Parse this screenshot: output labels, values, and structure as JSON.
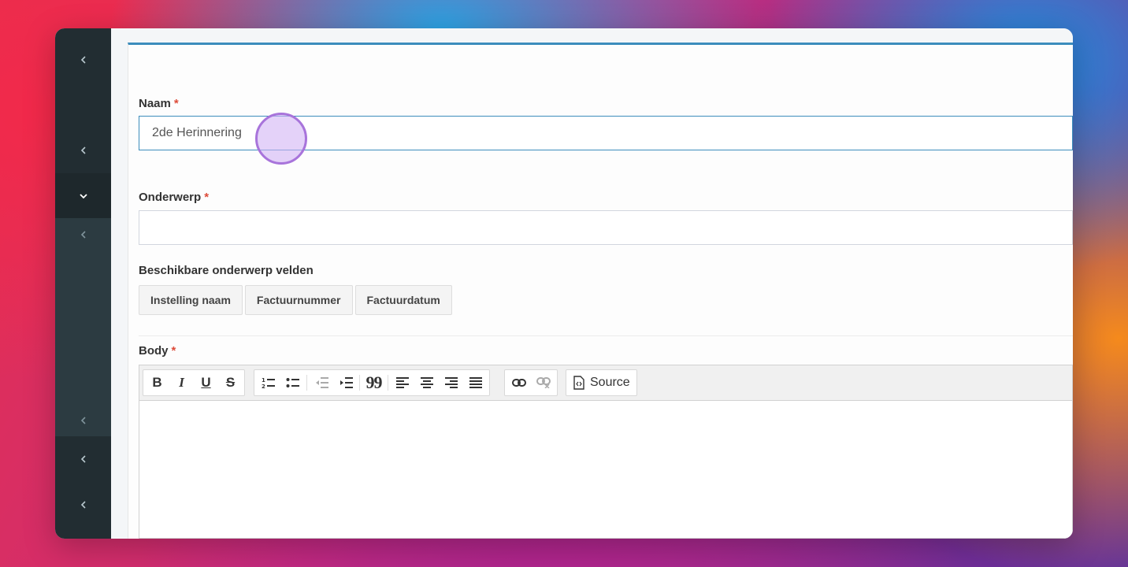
{
  "form": {
    "naam": {
      "label": "Naam",
      "required": "*",
      "value": "2de Herinnering"
    },
    "onderwerp": {
      "label": "Onderwerp",
      "required": "*",
      "value": ""
    },
    "available_fields": {
      "label": "Beschikbare onderwerp velden",
      "chips": [
        "Instelling naam",
        "Factuurnummer",
        "Factuurdatum"
      ]
    },
    "body": {
      "label": "Body",
      "required": "*",
      "toolbar": {
        "bold": "B",
        "italic": "I",
        "underline": "U",
        "strike": "S",
        "blockquote": "99",
        "source_label": "Source"
      }
    }
  },
  "sidebar": {
    "icons": [
      "chevron-left-icon",
      "chevron-left-icon",
      "chevron-down-icon",
      "chevron-left-icon",
      "chevron-left-icon",
      "chevron-left-icon",
      "chevron-left-icon"
    ]
  },
  "colors": {
    "accent": "#3c8dbc",
    "required": "#dd4b39",
    "sidebar": "#222d32",
    "cursor": "#a874db"
  }
}
